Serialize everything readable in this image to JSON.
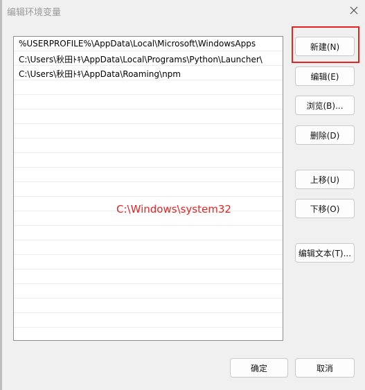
{
  "window": {
    "title": "编辑环境变量",
    "close_icon": "close-icon"
  },
  "path_list": {
    "items": [
      "%USERPROFILE%\\AppData\\Local\\Microsoft\\WindowsApps",
      "C:\\Users\\秋田ﾄｷ\\AppData\\Local\\Programs\\Python\\Launcher\\",
      "C:\\Users\\秋田ﾄｷ\\AppData\\Roaming\\npm"
    ]
  },
  "annotation": {
    "text": "C:\\Windows\\system32",
    "color": "#e52323"
  },
  "side_buttons": {
    "new": "新建(N)",
    "edit": "编辑(E)",
    "browse": "浏览(B)...",
    "delete": "删除(D)",
    "move_up": "上移(U)",
    "move_down": "下移(O)",
    "edit_text": "编辑文本(T)..."
  },
  "footer": {
    "ok": "确定",
    "cancel": "取消"
  }
}
